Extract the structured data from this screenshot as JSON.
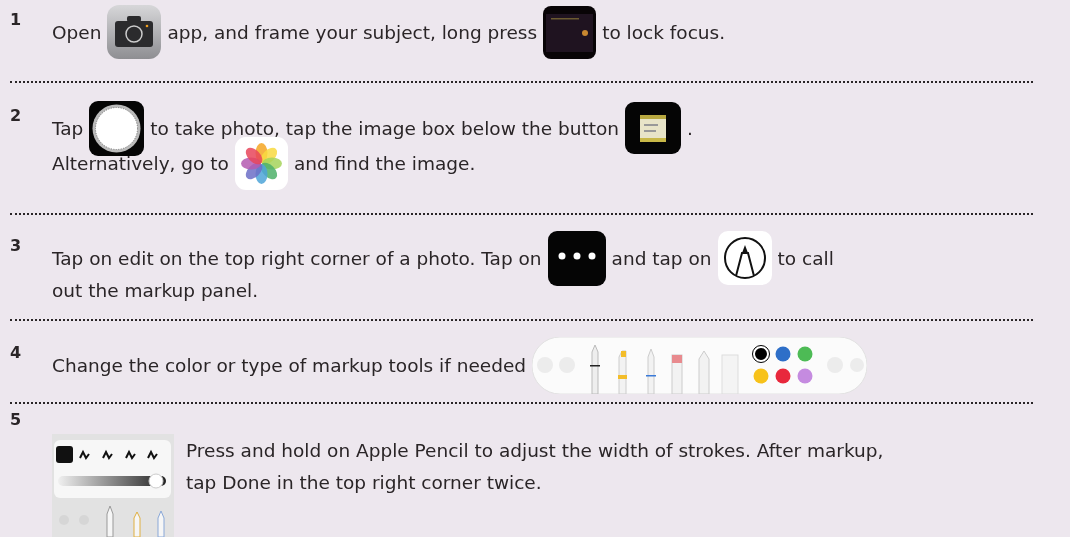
{
  "steps": [
    {
      "number": "1",
      "lines": [
        [
          {
            "kind": "text",
            "text": "Open"
          },
          {
            "kind": "camera"
          },
          {
            "kind": "text",
            "text": "app, and frame your subject, long press"
          },
          {
            "kind": "viewfinder"
          },
          {
            "kind": "text",
            "text": "to lock focus."
          }
        ]
      ]
    },
    {
      "number": "2",
      "lines": [
        [
          {
            "kind": "text",
            "text": "Tap"
          },
          {
            "kind": "shutter"
          },
          {
            "kind": "text",
            "text": "to take photo, tap the image box below the button"
          },
          {
            "kind": "thumbnail"
          },
          {
            "kind": "text",
            "text": "."
          }
        ],
        [
          {
            "kind": "text",
            "text": "Alternatively, go to"
          },
          {
            "kind": "photos"
          },
          {
            "kind": "text",
            "text": "and find the image."
          }
        ]
      ]
    },
    {
      "number": "3",
      "lines": [
        [
          {
            "kind": "text",
            "text": "Tap on edit on the top right corner of a photo. Tap on"
          },
          {
            "kind": "more"
          },
          {
            "kind": "text",
            "text": "and tap on"
          },
          {
            "kind": "markup"
          },
          {
            "kind": "text",
            "text": "to call"
          }
        ],
        [
          {
            "kind": "text",
            "text": "out the markup panel."
          }
        ]
      ]
    },
    {
      "number": "4",
      "lines": [
        [
          {
            "kind": "text",
            "text": "Change the color or type of markup tools if needed"
          },
          {
            "kind": "toolbar"
          }
        ]
      ]
    },
    {
      "number": "5",
      "with_panel": true,
      "lines": [
        [
          {
            "kind": "text",
            "text": "Press and hold on Apple Pencil to adjust the width of strokes. After markup,"
          }
        ],
        [
          {
            "kind": "text",
            "text": "tap Done in the top right corner twice."
          }
        ]
      ]
    }
  ]
}
